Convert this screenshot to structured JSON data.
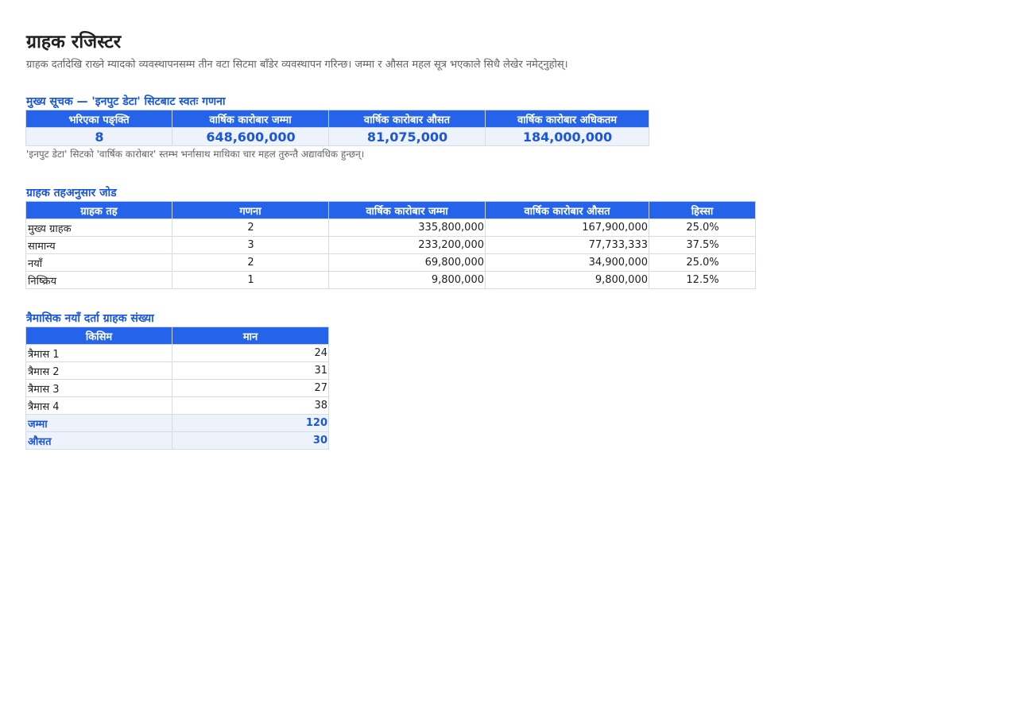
{
  "page": {
    "title": "ग्राहक रजिस्टर",
    "subtitle": "ग्राहक दर्तादेखि राख्ने म्यादको व्यवस्थापनसम्म तीन वटा सिटमा बाँडेर व्यवस्थापन गरिन्छ। जम्मा र औसत महल सूत्र भएकाले सिधै लेखेर नमेट्नुहोस्।"
  },
  "kpi": {
    "title": "मुख्य सूचक — 'इनपुट डेटा' सिटबाट स्वतः गणना",
    "headers": [
      "भरिएका पङ्क्ति",
      "वार्षिक कारोबार जम्मा",
      "वार्षिक कारोबार औसत",
      "वार्षिक कारोबार अधिकतम"
    ],
    "values": [
      "8",
      "648,600,000",
      "81,075,000",
      "184,000,000"
    ],
    "note": "'इनपुट डेटा' सिटको 'वार्षिक कारोबार' स्तम्भ भर्नासाथ माथिका चार महल तुरुन्तै अद्यावधिक हुन्छन्।"
  },
  "tiers": {
    "title": "ग्राहक तहअनुसार जोड",
    "headers": [
      "ग्राहक तह",
      "गणना",
      "वार्षिक कारोबार जम्मा",
      "वार्षिक कारोबार औसत",
      "हिस्सा"
    ],
    "rows": [
      [
        "मुख्य ग्राहक",
        "2",
        "335,800,000",
        "167,900,000",
        "25.0%"
      ],
      [
        "सामान्य",
        "3",
        "233,200,000",
        "77,733,333",
        "37.5%"
      ],
      [
        "नयाँ",
        "2",
        "69,800,000",
        "34,900,000",
        "25.0%"
      ],
      [
        "निष्क्रिय",
        "1",
        "9,800,000",
        "9,800,000",
        "12.5%"
      ]
    ]
  },
  "quarterly": {
    "title": "त्रैमासिक नयाँ दर्ता ग्राहक संख्या",
    "headers": [
      "किसिम",
      "मान"
    ],
    "rows": [
      [
        "त्रैमास 1",
        "24"
      ],
      [
        "त्रैमास 2",
        "31"
      ],
      [
        "त्रैमास 3",
        "27"
      ],
      [
        "त्रैमास 4",
        "38"
      ]
    ],
    "summary": [
      [
        "जम्मा",
        "120"
      ],
      [
        "औसत",
        "30"
      ]
    ]
  },
  "colors": {
    "accent": "#2563eb",
    "accent_text": "#1a56db",
    "summary_bg": "#eef2fb"
  }
}
